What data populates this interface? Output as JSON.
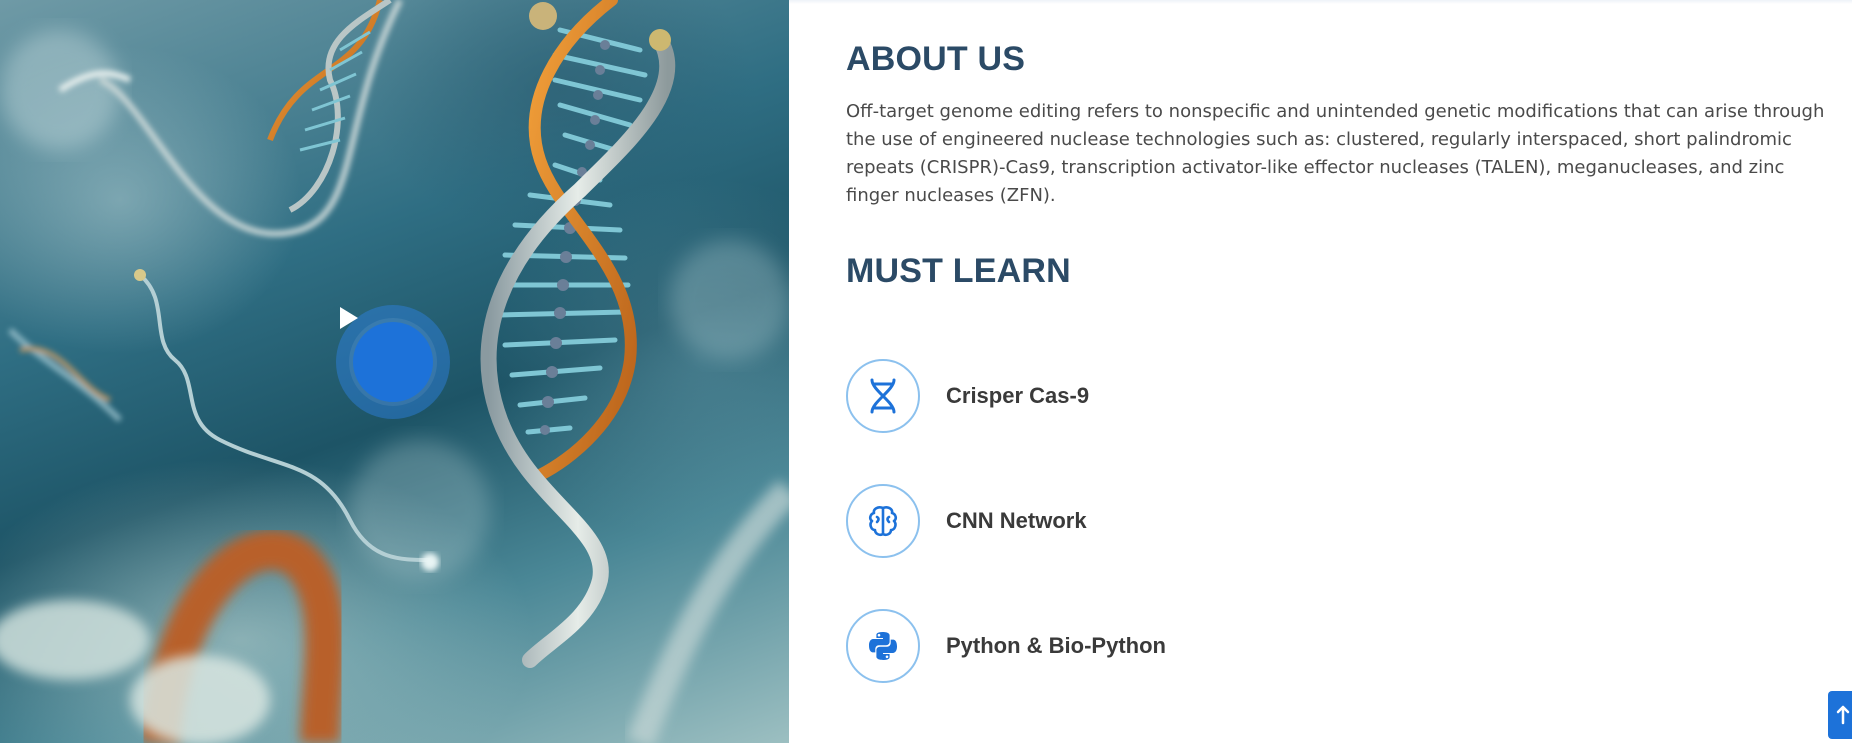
{
  "hero": {
    "play_icon": "play-icon",
    "accent_color": "#1d72d9"
  },
  "about": {
    "title": "ABOUT US",
    "text": "Off-target genome editing refers to nonspecific and unintended genetic modifications that can arise through the use of engineered nuclease technologies such as: clustered, regularly interspaced, short palindromic repeats (CRISPR)-Cas9, transcription activator-like effector nucleases (TALEN), meganucleases, and zinc finger nucleases (ZFN)."
  },
  "learn": {
    "title": "MUST LEARN",
    "items": [
      {
        "label": "Crisper Cas-9",
        "icon": "dna-icon"
      },
      {
        "label": "CNN Network",
        "icon": "brain-icon"
      },
      {
        "label": "Python & Bio-Python",
        "icon": "python-icon"
      }
    ]
  },
  "scroll_top": {
    "icon": "arrow-up-icon"
  },
  "colors": {
    "heading": "#2b4a66",
    "accent": "#1d72d9",
    "icon_border": "#8cc1ee"
  }
}
